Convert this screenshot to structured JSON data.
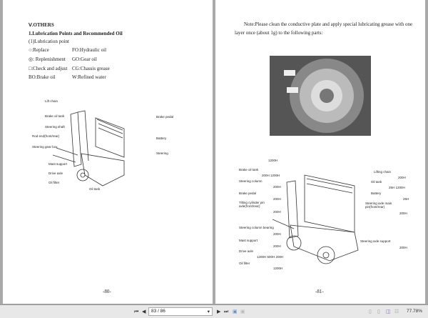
{
  "left_page": {
    "section": "Ⅴ.OTHERS",
    "heading": "1.Lubrication Points and Recommended Oil",
    "subheading": "(1)Lubrication point",
    "legend": [
      "○:Replace",
      "FO:Hydraulic oil",
      "◎: Replenishment",
      "GO:Gear oil",
      "□:Check and adjust",
      "CG:Chassis grease",
      "BO:Brake oil",
      "W:Refined water"
    ],
    "diagram_labels": [
      "Lift chain",
      "Brake oil tank",
      "Steering shaft",
      "Rod end(front/rear)",
      "Steering gear box",
      "Mast support",
      "Drive axle",
      "Oil filter",
      "Oil tank",
      "Brake pedal",
      "Battery",
      "Steering"
    ],
    "page_number": "-80-"
  },
  "right_page": {
    "note_line1": "Note:Please clean the conductive plate and apply special lubricating grease with one",
    "note_line2": "layer once (about 1g) to the following parts:",
    "left_labels": [
      {
        "label": "Brake oil tank",
        "interval": "200H 1200H"
      },
      {
        "label": "Steering column",
        "interval": "200H"
      },
      {
        "label": "Brake pedal",
        "interval": "200H"
      },
      {
        "label": "Tilting cylinder pin axle(front/rear)",
        "interval": "200H"
      },
      {
        "label": "Steering column bearing",
        "interval": "200H"
      },
      {
        "label": "Mast support",
        "interval": "200H"
      },
      {
        "label": "Drive axle",
        "interval": "1200H 600H 200H"
      },
      {
        "label": "Oil filter",
        "interval": "1200H"
      }
    ],
    "top_interval": "1200H",
    "right_labels": [
      {
        "label": "Lifting chain",
        "interval": "200H"
      },
      {
        "label": "Oil tank",
        "interval": "25H 1200H"
      },
      {
        "label": "Battery",
        "interval": "25H"
      },
      {
        "label": "Steering axle main pin(front/rear)",
        "interval": "200H"
      },
      {
        "label": "Steering axle support",
        "interval": "200H"
      }
    ],
    "page_number": "-81-"
  },
  "toolbar": {
    "page_field": "83 / 86",
    "zoom": "77.78%"
  }
}
